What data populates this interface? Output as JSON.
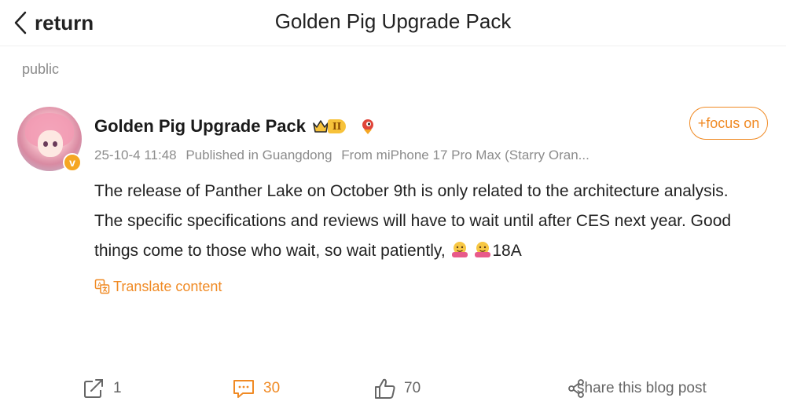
{
  "nav": {
    "back_label": "return",
    "title": "Golden Pig Upgrade Pack"
  },
  "visibility": "public",
  "post": {
    "author": {
      "name": "Golden Pig Upgrade Pack",
      "vip_level": "II",
      "verified_badge": "v"
    },
    "follow_label": "+focus on",
    "meta": {
      "timestamp": "25-10-4 11:48",
      "location": "Published in Guangdong",
      "source": "From miPhone 17 Pro Max (Starry Oran..."
    },
    "content_text": "The release of Panther Lake on October 9th is only related to the architecture analysis. The specific specifications and reviews will have to wait until after CES next year. Good things come to those who wait, so wait patiently,",
    "content_tail": "18A",
    "translate_label": "Translate content"
  },
  "actions": {
    "repost_count": "1",
    "comment_count": "30",
    "like_count": "70",
    "share_label": "share this blog post"
  },
  "colors": {
    "accent": "#f08a24",
    "muted": "#8c8c8c",
    "vip_gold": "#f7c23a"
  },
  "icons": [
    "back-chevron-icon",
    "crown-icon",
    "fan-bird-icon",
    "hug-emoji-icon",
    "translate-icon",
    "repost-icon",
    "comment-icon",
    "like-icon",
    "share-icon"
  ]
}
